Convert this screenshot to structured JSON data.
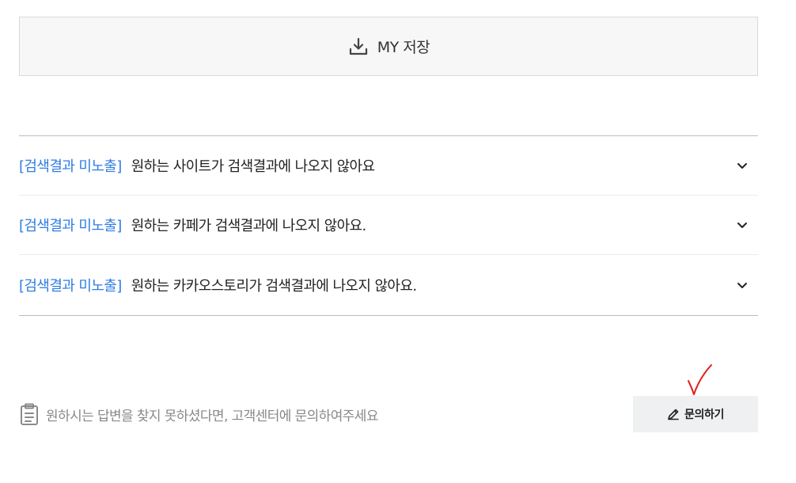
{
  "save": {
    "label": "MY 저장",
    "icon": "download-icon"
  },
  "faq": {
    "items": [
      {
        "category": "[검색결과 미노출]",
        "question": "원하는 사이트가 검색결과에 나오지 않아요"
      },
      {
        "category": "[검색결과 미노출]",
        "question": "원하는 카페가 검색결과에 나오지 않아요."
      },
      {
        "category": "[검색결과 미노출]",
        "question": "원하는 카카오스토리가 검색결과에 나오지 않아요."
      }
    ]
  },
  "footer": {
    "help_text": "원하시는 답변을 찾지 못하셨다면, 고객센터에 문의하여주세요",
    "inquiry_label": "문의하기"
  },
  "colors": {
    "accent": "#2f7de1",
    "annotation": "#e02020"
  }
}
